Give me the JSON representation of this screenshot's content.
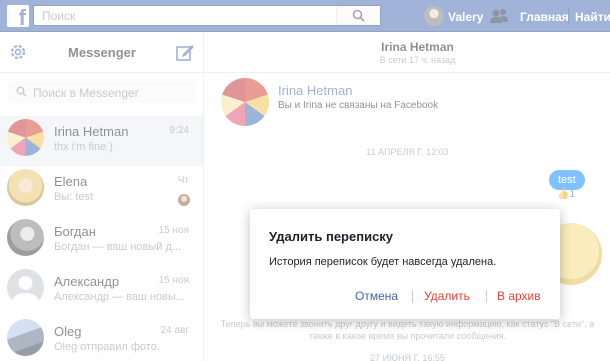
{
  "topbar": {
    "logo": "f",
    "search_placeholder": "Поиск",
    "user_name": "Valery",
    "nav_home": "Главная",
    "nav_find": "Найти д"
  },
  "sidebar": {
    "title": "Messenger",
    "search_placeholder": "Поиск в Messenger",
    "conversations": [
      {
        "name": "Irina Hetman",
        "preview": "thx i'm fine )",
        "time": "9:24"
      },
      {
        "name": "Elena",
        "preview": "Вы: test",
        "time": "Чт"
      },
      {
        "name": "Богдан",
        "preview": "Богдан — ваш новый д...",
        "time": "15 ноя"
      },
      {
        "name": "Александр",
        "preview": "Александр — ваш новы...",
        "time": "15 ноя"
      },
      {
        "name": "Oleg",
        "preview": "Oleg отправил фото.",
        "time": "24 авг"
      }
    ]
  },
  "chat": {
    "name": "Irina Hetman",
    "status": "В сети 17 ч. назад",
    "profile_name": "Irina Hetman",
    "profile_sub": "Вы и Irina не связаны на Facebook",
    "date1": "11 АПРЕЛЯ Г. 12:03",
    "bubble": "test",
    "like_count": "1",
    "system_msg": "Теперь вы можете звонить друг другу и видеть такую информацию, как статус \"В сети\", а также в какое время вы прочитали сообщения.",
    "date2": "27 ИЮНЯ Г. 16:55"
  },
  "dialog": {
    "title": "Удалить переписку",
    "message": "История переписок будет навсегда удалена.",
    "cancel": "Отмена",
    "delete": "Удалить",
    "archive": "В архив"
  },
  "colors": {
    "brand": "#4267b2",
    "danger": "#e0453a",
    "bubble": "#0084ff"
  }
}
